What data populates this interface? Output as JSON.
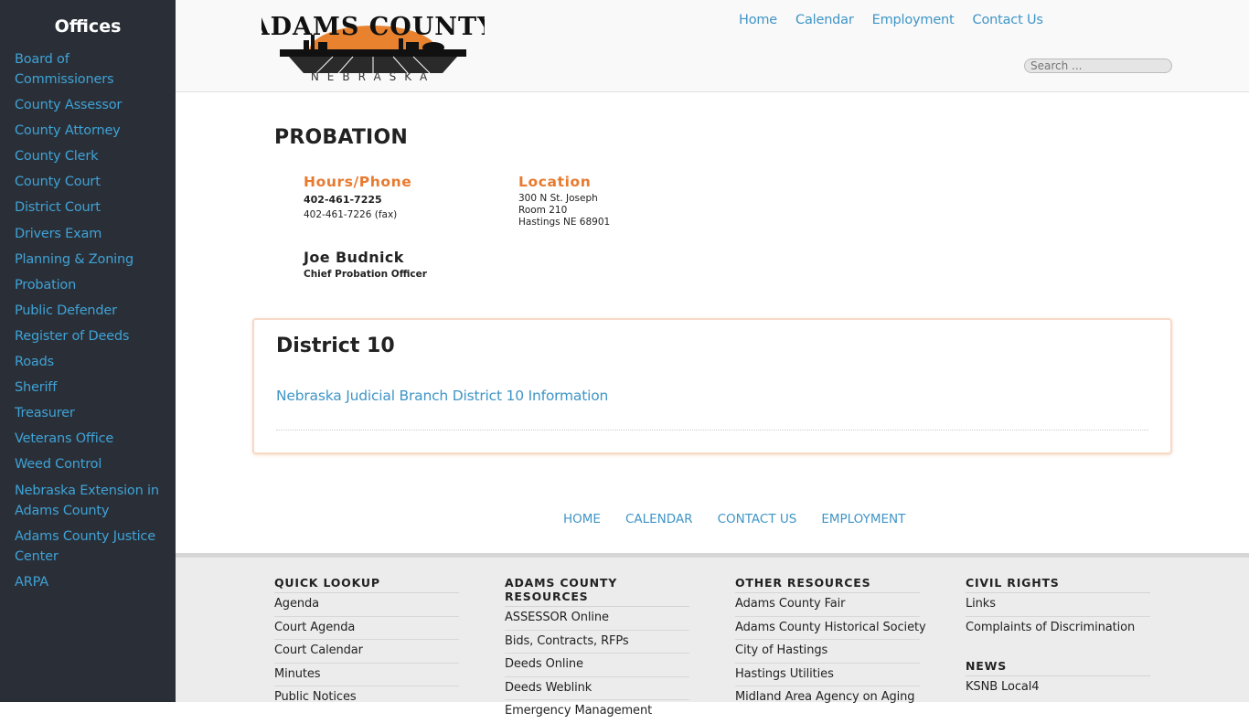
{
  "sidebar": {
    "title": "Offices",
    "items": [
      "Board of Commissioners",
      "County Assessor",
      "County Attorney",
      "County Clerk",
      "County Court",
      "District Court",
      "Drivers Exam",
      "Planning & Zoning",
      "Probation",
      "Public Defender",
      "Register of Deeds",
      "Roads",
      "Sheriff",
      "Treasurer",
      "Veterans Office",
      "Weed Control",
      "Nebraska Extension in Adams County",
      "Adams County Justice Center",
      "ARPA"
    ]
  },
  "header": {
    "logo_text": "ADAMS COUNTY",
    "logo_subtext": "NEBRASKA",
    "nav": [
      "Home",
      "Calendar",
      "Employment",
      "Contact Us"
    ],
    "search_placeholder": "Search ..."
  },
  "main": {
    "title": "PROBATION",
    "hours": {
      "heading": "Hours/Phone",
      "phone": "402-461-7225",
      "fax": "402-461-7226 (fax)"
    },
    "location": {
      "heading": "Location",
      "line1": "300 N St. Joseph",
      "line2": "Room 210",
      "line3": "Hastings NE 68901"
    },
    "officer": {
      "name": "Joe Budnick",
      "title": "Chief Probation Officer"
    },
    "district": {
      "title": "District 10",
      "link": "Nebraska Judicial Branch District 10 Information"
    },
    "footer_nav": [
      "HOME",
      "CALENDAR",
      "CONTACT US",
      "EMPLOYMENT"
    ]
  },
  "footer": {
    "quick_lookup": {
      "heading": "QUICK LOOKUP",
      "items": [
        "Agenda",
        "Court Agenda",
        "Court Calendar",
        "Minutes",
        "Public Notices"
      ]
    },
    "resources": {
      "heading": "ADAMS COUNTY RESOURCES",
      "items": [
        "ASSESSOR Online",
        "Bids, Contracts, RFPs",
        "Deeds Online",
        "Deeds Weblink",
        "Emergency Management"
      ]
    },
    "other": {
      "heading": "OTHER RESOURCES",
      "items": [
        "Adams County Fair",
        "Adams County Historical Society",
        "City of Hastings",
        "Hastings Utilities",
        "Midland Area Agency on Aging"
      ]
    },
    "civil_rights": {
      "heading": "CIVIL RIGHTS",
      "items": [
        "Links",
        "Complaints of Discrimination"
      ]
    },
    "news": {
      "heading": "NEWS",
      "items": [
        "KSNB Local4"
      ]
    }
  },
  "colors": {
    "sidebar_bg": "#2a2f37",
    "link": "#3f95c6",
    "accent": "#e87a2f"
  }
}
